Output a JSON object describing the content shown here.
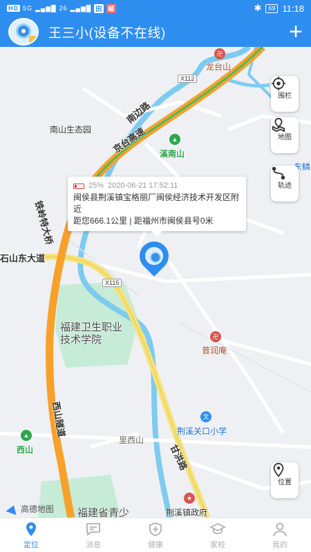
{
  "status_bar": {
    "hd_tag": "HD",
    "signal": "5G",
    "signal2": "26",
    "app_tag": "邮",
    "battery": "69",
    "time": "11:18"
  },
  "header": {
    "title": "王三小(设备不在线)",
    "add_label": "+"
  },
  "map": {
    "labels": {
      "longtaishan": "龙台山",
      "nanshan_park": "南山生态园",
      "xinanshan": "溪南山",
      "dongshan": "东鳞",
      "shishan_road": "石山东大道",
      "fujian_college": "福建卫生职业技术学院",
      "purunan": "普润庵",
      "jingxi_school": "荆溪关口小学",
      "xishan": "西山",
      "lixishan": "里西山",
      "jingxi_gov": "荆溪镇政府",
      "fujian_youth": "福建省青少",
      "road_nanbian": "南边路",
      "road_jingtai": "京台高速",
      "road_tieling": "铁岭特大桥",
      "road_xishan_tunnel": "西山隧道",
      "road_ganzhou": "甘洪路",
      "road_x112": "X112",
      "road_x115": "X115"
    },
    "info_card": {
      "battery_pct": "25%",
      "datetime": "2020-06-21 17:52:11",
      "address": "闽侯县荆溪镇宝格丽厂闽侯经济技术开发区附近",
      "distance": "距您666.1公里 | 距福州市闽侯县号0米"
    },
    "tools": {
      "fence": "围栏",
      "map": "地图",
      "track": "轨迹",
      "position": "位置"
    },
    "logo": "高德地图"
  },
  "tabs": [
    {
      "label": "定位",
      "icon": "location-icon",
      "active": true
    },
    {
      "label": "消息",
      "icon": "message-icon",
      "active": false
    },
    {
      "label": "健康",
      "icon": "health-icon",
      "active": false
    },
    {
      "label": "家校",
      "icon": "school-icon",
      "active": false
    },
    {
      "label": "我的",
      "icon": "user-icon",
      "active": false
    }
  ],
  "colors": {
    "primary": "#2e8ef0",
    "highway": "#f7a12b",
    "river": "#7ecbf0",
    "green_area": "#c6ecd8",
    "road_yellow": "#f5e27a"
  }
}
